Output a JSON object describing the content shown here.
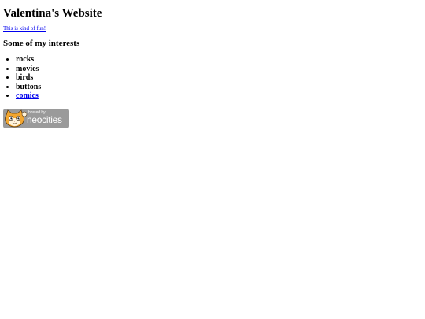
{
  "site": {
    "title": "Valentina's Website",
    "sub_link": "This is kind of fun!"
  },
  "interests": {
    "heading": "Some of my interests",
    "items": [
      {
        "label": "rocks"
      },
      {
        "label": "movies"
      },
      {
        "label": "birds"
      },
      {
        "label": "buttons"
      },
      {
        "label": "comics"
      }
    ]
  },
  "badge": {
    "small_text": "hosted by",
    "big_text": "neocities",
    "icon": "neocities-cat-icon",
    "background_color": "#9a9a9a"
  },
  "colors": {
    "link": "#0000ee",
    "text": "#000000",
    "background": "#ffffff"
  }
}
